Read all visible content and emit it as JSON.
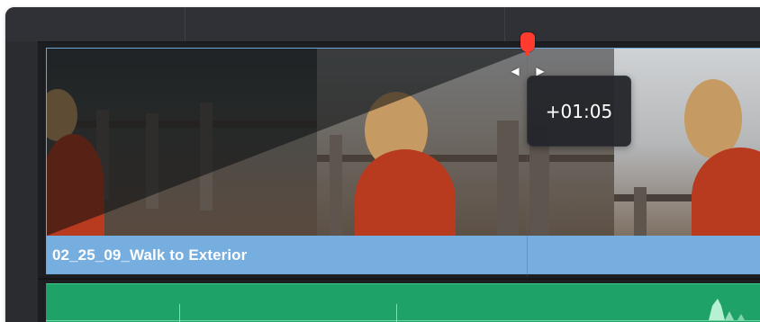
{
  "timeline": {
    "video_track": {
      "clip": {
        "name": "02_25_09_Walk to Exterior"
      }
    },
    "slip_tooltip": {
      "text": "+01:05"
    }
  },
  "colors": {
    "panel_background": "#2a2c30",
    "video_clip_label": "#77aee0",
    "audio_clip": "#1ea267",
    "playhead": "#ff3b30",
    "tooltip_background": "#23252a"
  },
  "icons": {
    "playhead": "playhead-icon",
    "trim_left": "trim-left-arrow-icon",
    "trim_right": "trim-right-arrow-icon"
  }
}
